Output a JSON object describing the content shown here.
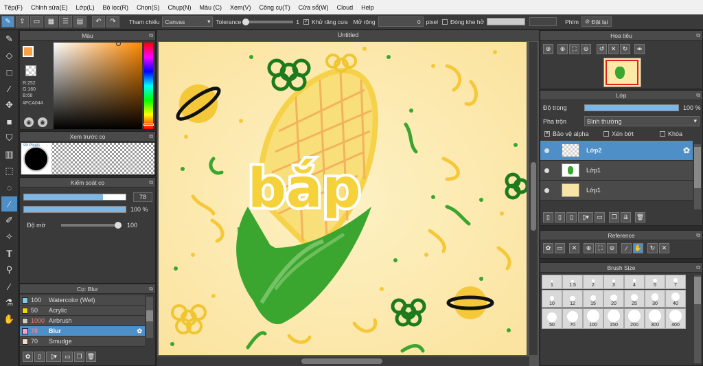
{
  "menu": [
    "Tệp(F)",
    "Chỉnh sửa(E)",
    "Lớp(L)",
    "Bộ lọc(R)",
    "Chọn(S)",
    "Chụp(N)",
    "Màu (C)",
    "Xem(V)",
    "Công cụ(T)",
    "Cửa sổ(W)",
    "Cloud",
    "Help"
  ],
  "toolbar": {
    "ref_label": "Tham chiếu",
    "ref_value": "Canvas",
    "tolerance_label": "Tolerance",
    "tolerance_value": "1",
    "antialias_label": "Khử răng cưa",
    "expand_label": "Mở rộng",
    "expand_value": "0",
    "expand_unit": "pixel",
    "close_gap_label": "Đóng khe hở",
    "extra_label": "Phím",
    "undo_label": "Đặt lại"
  },
  "color_panel": {
    "title": "Màu",
    "r": "R:252",
    "g": "G:160",
    "b": "B:68",
    "hex": "#FCA044",
    "fg_color": "#FCA044"
  },
  "brush_preview": {
    "title": "Xem trước cọ",
    "size_text": "99 Pixels"
  },
  "brush_control": {
    "title": "Kiểm soát cọ",
    "size_value": "78",
    "opacity_value": "100 %",
    "density_label": "Độ mờ",
    "density_value": "100",
    "size_frac": 0.78,
    "opacity_frac": 1.0,
    "density_frac": 1.0
  },
  "brush_list": {
    "title": "Cọ: Blur",
    "items": [
      {
        "size": "100",
        "name": "Watercolor (Wet)",
        "color": "#7ecbf0"
      },
      {
        "size": "50",
        "name": "Acrylic",
        "color": "#f5d400"
      },
      {
        "size": "1000",
        "name": "Airbrush",
        "color": "#cccccc"
      },
      {
        "size": "78",
        "name": "Blur",
        "color": "#f5a0e0"
      },
      {
        "size": "70",
        "name": "Smudge",
        "color": "#f7d8c4"
      }
    ]
  },
  "document": {
    "title": "Untitled",
    "lettering": "bắp"
  },
  "navigator": {
    "title": "Hoa tiêu"
  },
  "layers": {
    "title": "Lớp",
    "opacity_label": "Độ trong",
    "opacity_value": "100 %",
    "opacity_frac": 1.0,
    "blend_label": "Pha trộn",
    "blend_value": "Bình thường",
    "protect_alpha": "Bảo vệ alpha",
    "clipping": "Xén bớt",
    "lock": "Khóa",
    "items": [
      {
        "name": "Lớp2"
      },
      {
        "name": "Lớp1"
      },
      {
        "name": "Lớp1"
      }
    ]
  },
  "reference": {
    "title": "Reference"
  },
  "brush_size": {
    "title": "Brush Size",
    "sizes": [
      "1",
      "1.5",
      "2",
      "3",
      "4",
      "5",
      "7",
      "10",
      "12",
      "15",
      "20",
      "25",
      "30",
      "40",
      "50",
      "70",
      "100",
      "150",
      "200",
      "300",
      "400"
    ]
  },
  "colors": {
    "accent": "#4e8fc7",
    "canvas_bg": "#fce9a8"
  }
}
